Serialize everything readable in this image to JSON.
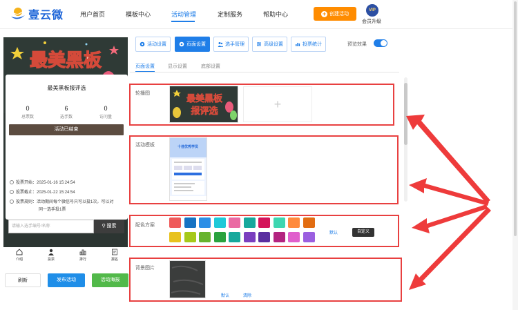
{
  "brand": {
    "name": "壹云微"
  },
  "nav": {
    "items": [
      "用户首页",
      "模板中心",
      "活动管理",
      "定制服务",
      "帮助中心"
    ],
    "active_index": 2,
    "create_label": "创建活动",
    "vip_badge": "VIP",
    "vip_label": "会员升级"
  },
  "preview": {
    "banner_title": "最美黑板报评选",
    "title": "最美黑板报评选",
    "stats": [
      {
        "value": "0",
        "label": "总票数"
      },
      {
        "value": "6",
        "label": "选手数"
      },
      {
        "value": "0",
        "label": "访问量"
      }
    ],
    "status": "活动已结束",
    "lines": [
      "投票开始：2025-01-16 15:24:54",
      "投票截止：2025-01-22 15:24:54",
      "投票规则：活动期间每个微信号只可以投1次，可以对",
      "同一选手投1票"
    ],
    "search_placeholder": "请输入选手编号/名称",
    "search_button": "搜索",
    "tabs": [
      "介绍",
      "投票",
      "排行",
      "报名"
    ],
    "buttons": [
      "刷新",
      "发布活动",
      "活动海报"
    ]
  },
  "toolbar": {
    "buttons": [
      "活动设置",
      "页面设置",
      "选手管理",
      "高级设置",
      "投票统计"
    ],
    "active_index": 1,
    "preview_label": "预览效果",
    "preview_on": true
  },
  "subtabs": {
    "items": [
      "页面设置",
      "显示设置",
      "底部设置"
    ],
    "active_index": 0
  },
  "sections": {
    "carousel_label": "轮播图",
    "carousel_thumb_text": "最美黑板报评选",
    "template_label": "活动模板",
    "template_thumb_title": "十佳优秀学员",
    "color_label": "配色方案",
    "color_default": "默认",
    "color_custom": "自定义",
    "colors": [
      "#ef5b5b",
      "#1673c3",
      "#2d8fe6",
      "#1ec9d8",
      "#ea6aa3",
      "#17a89c",
      "#d4145a",
      "#3dd6b0",
      "#ff8a3d",
      "#e26d12",
      "#e8c21e",
      "#a6c91a",
      "#67b32e",
      "#2aa23e",
      "#17a89c",
      "#7a3fbf",
      "#5a2fa0",
      "#b32480",
      "#e05fcc",
      "#9b5fe0"
    ],
    "bg_label": "背景图片",
    "bg_default": "默认",
    "bg_clear": "清除"
  }
}
